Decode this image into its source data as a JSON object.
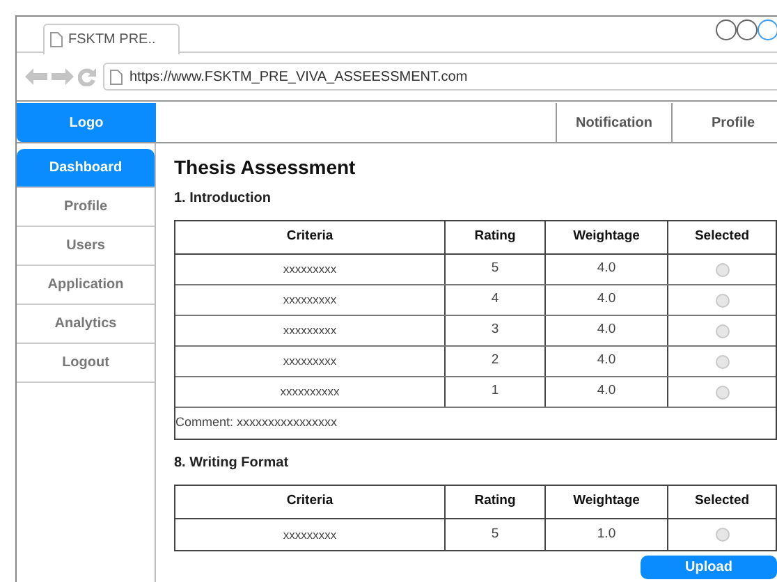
{
  "browser": {
    "tab_title": "FSKTM PRE..",
    "url": "https://www.FSKTM_PRE_VIVA_ASSEESSMENT.com"
  },
  "header": {
    "logo": "Logo",
    "links": [
      "Notification",
      "Profile"
    ]
  },
  "sidebar": {
    "items": [
      {
        "label": "Dashboard",
        "selected": true
      },
      {
        "label": "Profile",
        "selected": false
      },
      {
        "label": "Users",
        "selected": false
      },
      {
        "label": "Application",
        "selected": false
      },
      {
        "label": "Analytics",
        "selected": false
      },
      {
        "label": "Logout",
        "selected": false
      }
    ]
  },
  "title": "Thesis Assessment",
  "sections": [
    {
      "heading": "1. Introduction",
      "columns": [
        "Criteria",
        "Rating",
        "Weightage",
        "Selected"
      ],
      "rows": [
        {
          "criteria": "xxxxxxxxx",
          "rating": "5",
          "weightage": "4.0",
          "selected": false
        },
        {
          "criteria": "xxxxxxxxx",
          "rating": "4",
          "weightage": "4.0",
          "selected": false
        },
        {
          "criteria": "xxxxxxxxx",
          "rating": "3",
          "weightage": "4.0",
          "selected": false
        },
        {
          "criteria": "xxxxxxxxx",
          "rating": "2",
          "weightage": "4.0",
          "selected": false
        },
        {
          "criteria": "xxxxxxxxxx",
          "rating": "1",
          "weightage": "4.0",
          "selected": false
        }
      ],
      "comment": "Comment: xxxxxxxxxxxxxxxx"
    },
    {
      "heading": "8. Writing Format",
      "columns": [
        "Criteria",
        "Rating",
        "Weightage",
        "Selected"
      ],
      "rows": [
        {
          "criteria": "xxxxxxxxx",
          "rating": "5",
          "weightage": "1.0",
          "selected": false
        }
      ]
    }
  ],
  "upload_button": "Upload"
}
